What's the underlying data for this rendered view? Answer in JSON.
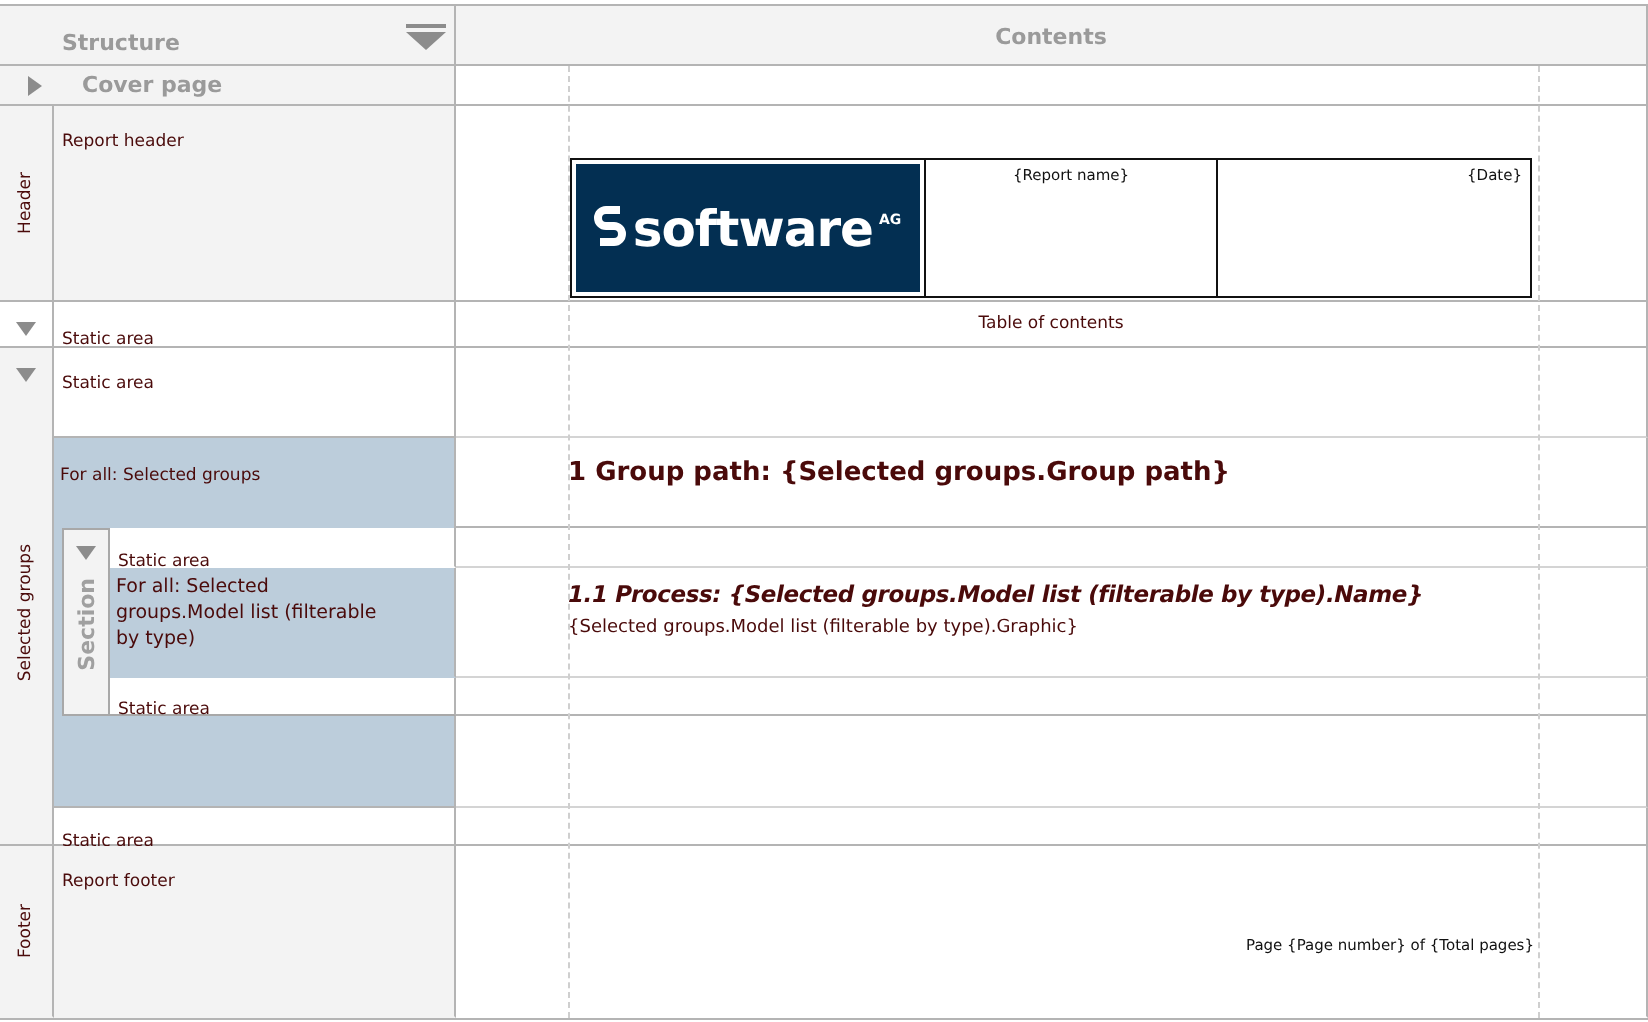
{
  "structure_header": {
    "title": "Structure"
  },
  "contents_header": {
    "title": "Contents"
  },
  "cover_page": {
    "label": "Cover page",
    "expanded": false
  },
  "header": {
    "band_label": "Header",
    "area_label": "Report header",
    "logo": {
      "text": "software",
      "superscript": "AG"
    },
    "report_name": "{Report name}",
    "date": "{Date}"
  },
  "toc": {
    "label": "Static area",
    "expanded": true,
    "text": "Table of contents"
  },
  "selected_groups": {
    "band_label": "Selected groups",
    "expanded": true,
    "top_static": "Static area",
    "for_all": "For all: Selected groups",
    "group_heading": "1 Group path: {Selected groups.Group path}",
    "section": {
      "label": "Section",
      "expanded": true,
      "top_static": "Static area",
      "for_all": "For all: Selected groups.Model list (filterable by type)",
      "process_heading": "1.1 Process: {Selected groups.Model list (filterable by type).Name}",
      "graphic": "{Selected groups.Model list (filterable by type).Graphic}",
      "bottom_static": "Static area"
    },
    "bottom_static": "Static area"
  },
  "footer": {
    "band_label": "Footer",
    "area_label": "Report footer",
    "page_text": "Page {Page number} of {Total pages}"
  }
}
